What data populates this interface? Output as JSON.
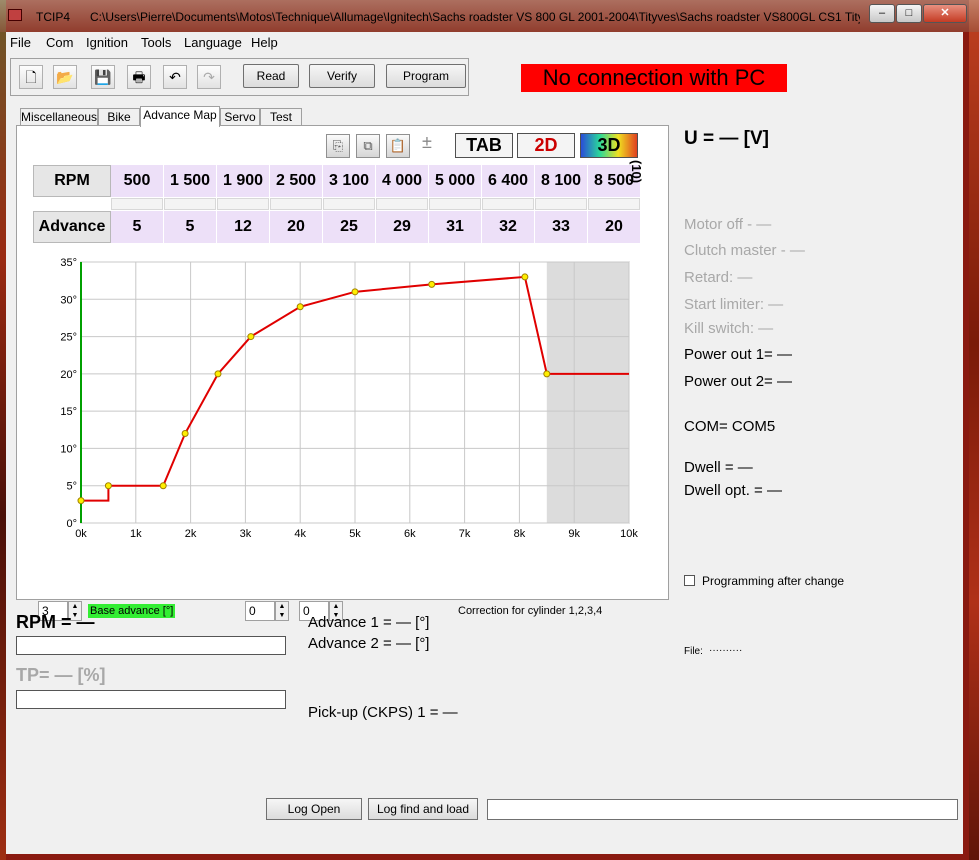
{
  "window": {
    "app_title": "TCIP4",
    "path": "C:\\Users\\Pierre\\Documents\\Motos\\Technique\\Allumage\\Ignitech\\Sachs roadster VS 800 GL 2001-2004\\Tityves\\Sachs roadster VS800GL CS1 Tity..."
  },
  "menu": {
    "file": "File",
    "com": "Com",
    "ignition": "Ignition",
    "tools": "Tools",
    "language": "Language",
    "help": "Help"
  },
  "toolbar": {
    "read": "Read",
    "verify": "Verify",
    "program": "Program"
  },
  "status": {
    "no_connection": "No connection with PC"
  },
  "tabs": {
    "misc": "Miscellaneous",
    "bike": "Bike",
    "advance_map": "Advance Map",
    "servo": "Servo",
    "test": "Test"
  },
  "view_buttons": {
    "tab": "TAB",
    "two_d": "2D",
    "three_d": "3D"
  },
  "grid": {
    "rpm_label": "RPM",
    "advance_label": "Advance",
    "rpm": [
      "500",
      "1 500",
      "1 900",
      "2 500",
      "3 100",
      "4 000",
      "5 000",
      "6 400",
      "8 100",
      "8 500"
    ],
    "advance": [
      "5",
      "5",
      "12",
      "20",
      "25",
      "29",
      "31",
      "32",
      "33",
      "20"
    ],
    "count": "(10)"
  },
  "chart_data": {
    "type": "line",
    "x": [
      0,
      500,
      500,
      1500,
      1900,
      2500,
      3100,
      4000,
      5000,
      6400,
      8100,
      8500,
      10000
    ],
    "y": [
      3,
      3,
      5,
      5,
      12,
      20,
      25,
      29,
      31,
      32,
      33,
      20,
      20
    ],
    "points_x": [
      0,
      500,
      1500,
      1900,
      2500,
      3100,
      4000,
      5000,
      6400,
      8100,
      8500
    ],
    "points_y": [
      3,
      5,
      5,
      12,
      20,
      25,
      29,
      31,
      32,
      33,
      20
    ],
    "x_ticks": [
      "0k",
      "1k",
      "2k",
      "3k",
      "4k",
      "5k",
      "6k",
      "7k",
      "8k",
      "9k",
      "10k"
    ],
    "y_ticks": [
      "0°",
      "5°",
      "10°",
      "15°",
      "20°",
      "25°",
      "30°",
      "35°"
    ],
    "xlim": [
      0,
      10000
    ],
    "ylim": [
      0,
      35
    ],
    "shaded_from_x": 8500,
    "grid": true,
    "line_color": "#e00000",
    "point_color": "#ffee00"
  },
  "controls": {
    "base_advance_value": "3",
    "base_advance_label": "Base advance [°]",
    "spin1": "0",
    "spin2": "0",
    "correction_label": "Correction for cylinder 1,2,3,4"
  },
  "readouts": {
    "rpm": "RPM = —",
    "tp": "TP= — [%]",
    "advance1": "Advance 1 = — [°]",
    "advance2": "Advance 2 = — [°]",
    "pickup": "Pick-up (CKPS) 1 = —"
  },
  "right_panel": {
    "voltage": "U = — [V]",
    "motor_off": "Motor off - —",
    "clutch_master": "Clutch master - —",
    "retard": "Retard: —",
    "start_limiter": "Start limiter: —",
    "kill_switch": "Kill switch: —",
    "power_out1": "Power out 1= —",
    "power_out2": "Power out 2= —",
    "com": "COM= COM5",
    "dwell": "Dwell = —",
    "dwell_opt": "Dwell opt. = —",
    "programming_after_change": "Programming after change",
    "file_label": "File:",
    "file_value": "··········"
  },
  "bottom": {
    "log_open": "Log Open",
    "log_find_load": "Log find and load",
    "log_path": ""
  }
}
